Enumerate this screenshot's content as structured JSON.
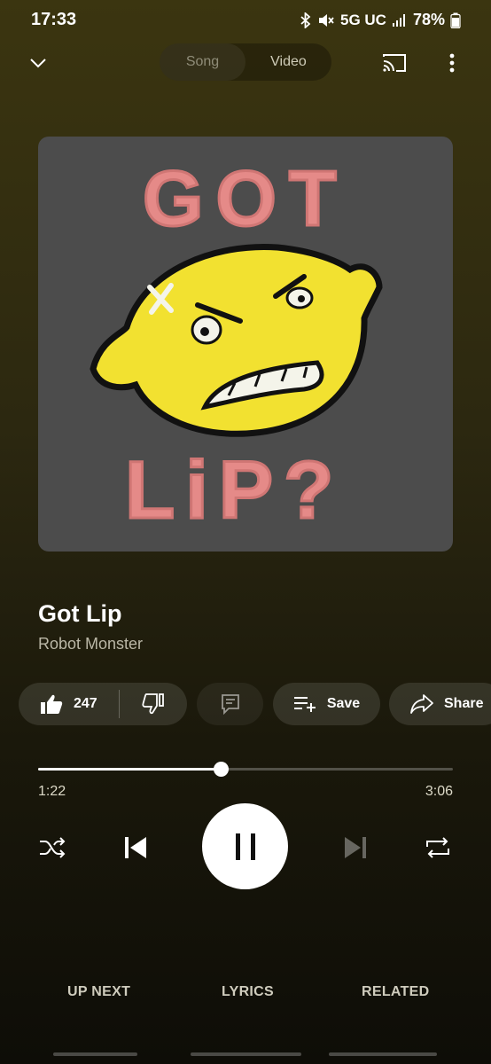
{
  "status_bar": {
    "time": "17:33",
    "network": "5G UC",
    "battery": "78%",
    "icons": [
      "bluetooth-icon",
      "mute-icon",
      "signal-icon",
      "battery-icon"
    ]
  },
  "top_nav": {
    "tabs": [
      {
        "label": "Song",
        "active": true
      },
      {
        "label": "Video",
        "active": false
      }
    ],
    "icons": [
      "chevron-down-icon",
      "cast-icon",
      "more-vert-icon"
    ]
  },
  "album_art": {
    "text_top": "GOT",
    "text_bottom": "LiP?",
    "background_color": "#4c4c4c",
    "text_color": "#e58a88",
    "face_color": "#f2e130"
  },
  "track": {
    "title": "Got Lip",
    "artist": "Robot Monster"
  },
  "actions": {
    "like_count": "247",
    "save_label": "Save",
    "share_label": "Share"
  },
  "player": {
    "current_time": "1:22",
    "total_time": "3:06",
    "progress": 0.44
  },
  "bottom_tabs": {
    "up_next": "UP NEXT",
    "lyrics": "LYRICS",
    "related": "RELATED"
  }
}
